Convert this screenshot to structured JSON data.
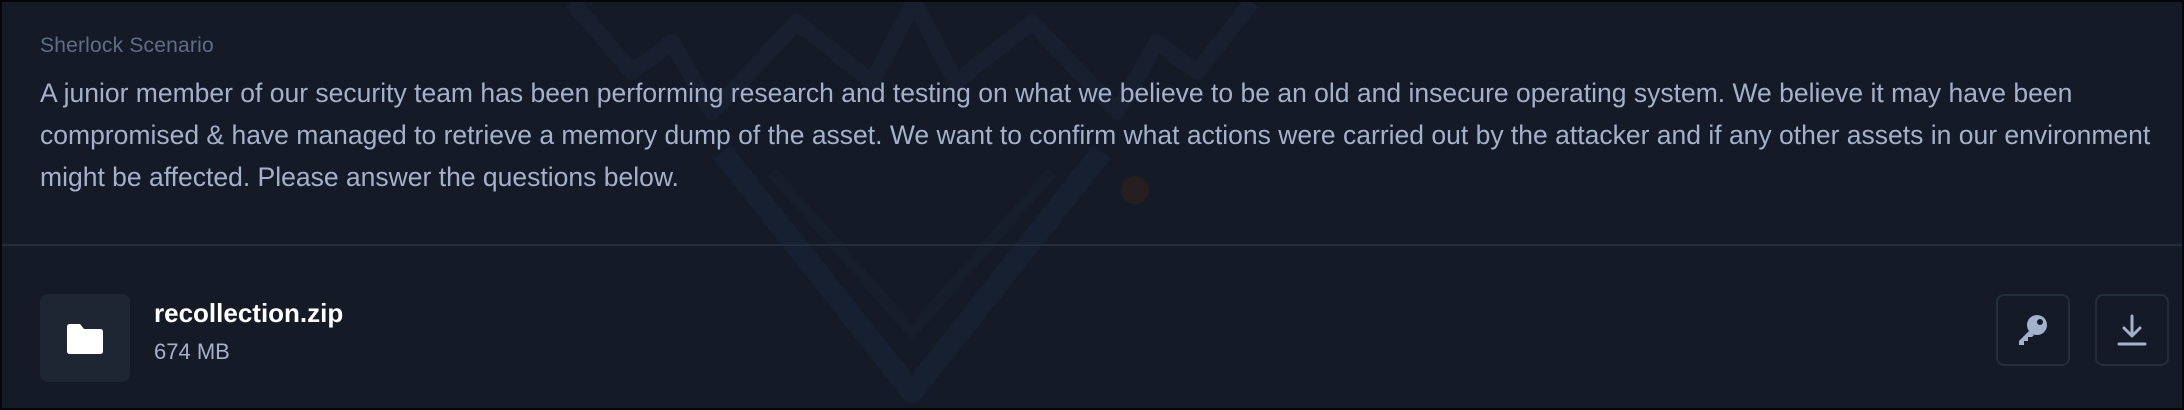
{
  "scenario": {
    "label": "Sherlock Scenario",
    "description": "A junior member of our security team has been performing research and testing on what we believe to be an old and insecure operating system. We believe it may have been compromised & have managed to retrieve a memory dump of the asset. We want to confirm what actions were carried out by the attacker and if any other assets in our environment might be affected. Please answer the questions below."
  },
  "file": {
    "name": "recollection.zip",
    "size": "674 MB",
    "icon": "folder-icon"
  },
  "actions": {
    "key_icon": "key-icon",
    "download_icon": "download-icon"
  },
  "colors": {
    "background": "#141b26",
    "label": "#5f6d86",
    "text": "#a4b1cd",
    "title": "#ffffff",
    "tile": "#1e2633",
    "border": "#232d3c",
    "icon": "#a4b1cd"
  }
}
